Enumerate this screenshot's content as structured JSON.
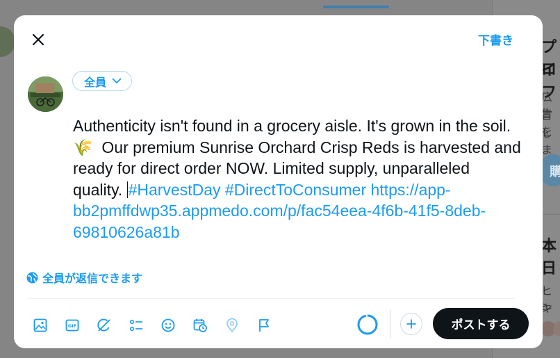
{
  "modal": {
    "drafts_label": "下書き",
    "audience_label": "全員",
    "reply_setting_label": "全員が返信できます",
    "post_label": "ポストする"
  },
  "compose": {
    "text_before": "Authenticity isn't found in a grocery aisle. It's grown in the soil. ",
    "emoji": "🌾",
    "text_middle": "  Our premium Sunrise Orchard Crisp Reds is harvested and ready for direct order NOW. Limited supply, unparalleled quality. ",
    "hashtags": "#HarvestDay #DirectToConsumer",
    "link": "https://app-bb2pmffdwp35.appmedo.com/p/fac54eea-4f6b-41f5-8deb-69810626a81b"
  },
  "background": {
    "right_chars_1": "プロ",
    "right_chars_2": "イフ",
    "right_small_1": "広告",
    "right_small_2": "言を",
    "right_small_3": "しま",
    "right_chars_3": "本日",
    "right_small_4": "ヒン",
    "right_small_5": "キャ",
    "right_button_char": "購"
  },
  "toolbar_icons": [
    "image-icon",
    "gif-icon",
    "grok-icon",
    "poll-icon",
    "emoji-icon",
    "schedule-icon",
    "location-icon",
    "flag-icon"
  ],
  "colors": {
    "accent": "#1d9bf0",
    "post_button": "#0f1419",
    "text": "#0f1419"
  }
}
